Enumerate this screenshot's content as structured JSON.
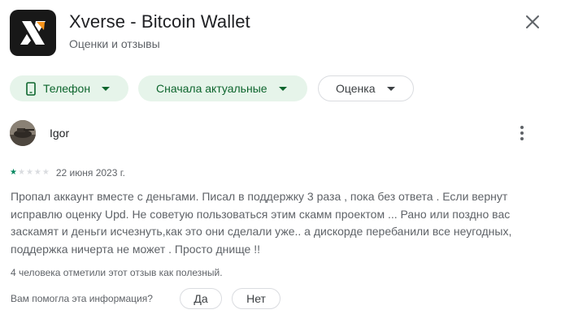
{
  "app": {
    "title": "Xverse - Bitcoin Wallet",
    "subtitle": "Оценки и отзывы",
    "icon": "xverse-logo-icon",
    "accent": "#f7931a"
  },
  "filters": {
    "device": "Телефон",
    "sort": "Сначала актуальные",
    "rating": "Оценка"
  },
  "review": {
    "author": "Igor",
    "rating": 1,
    "rating_max": 5,
    "date": "22 июня 2023 г.",
    "text": "Пропал аккаунт вместе с деньгами. Писал в поддержку 3 раза , пока без ответа . Если вернут исправлю оценку Upd. Не советую пользоваться этим скамм проектом ... Рано или поздно вас заскамят и деньги исчезнуть,как это они сделали уже.. а дискорде перебанили все неугодных, поддержка ничерта не может . Просто днище !!",
    "helpful_count": "4 человека отметили этот отзыв как полезный.",
    "feedback_question": "Вам помогла эта информация?",
    "yes_label": "Да",
    "no_label": "Нет"
  },
  "colors": {
    "chip_selected_bg": "#e6f4ea",
    "chip_selected_text": "#0d652d",
    "star_filled": "#01875f",
    "star_empty": "#dadce0"
  }
}
